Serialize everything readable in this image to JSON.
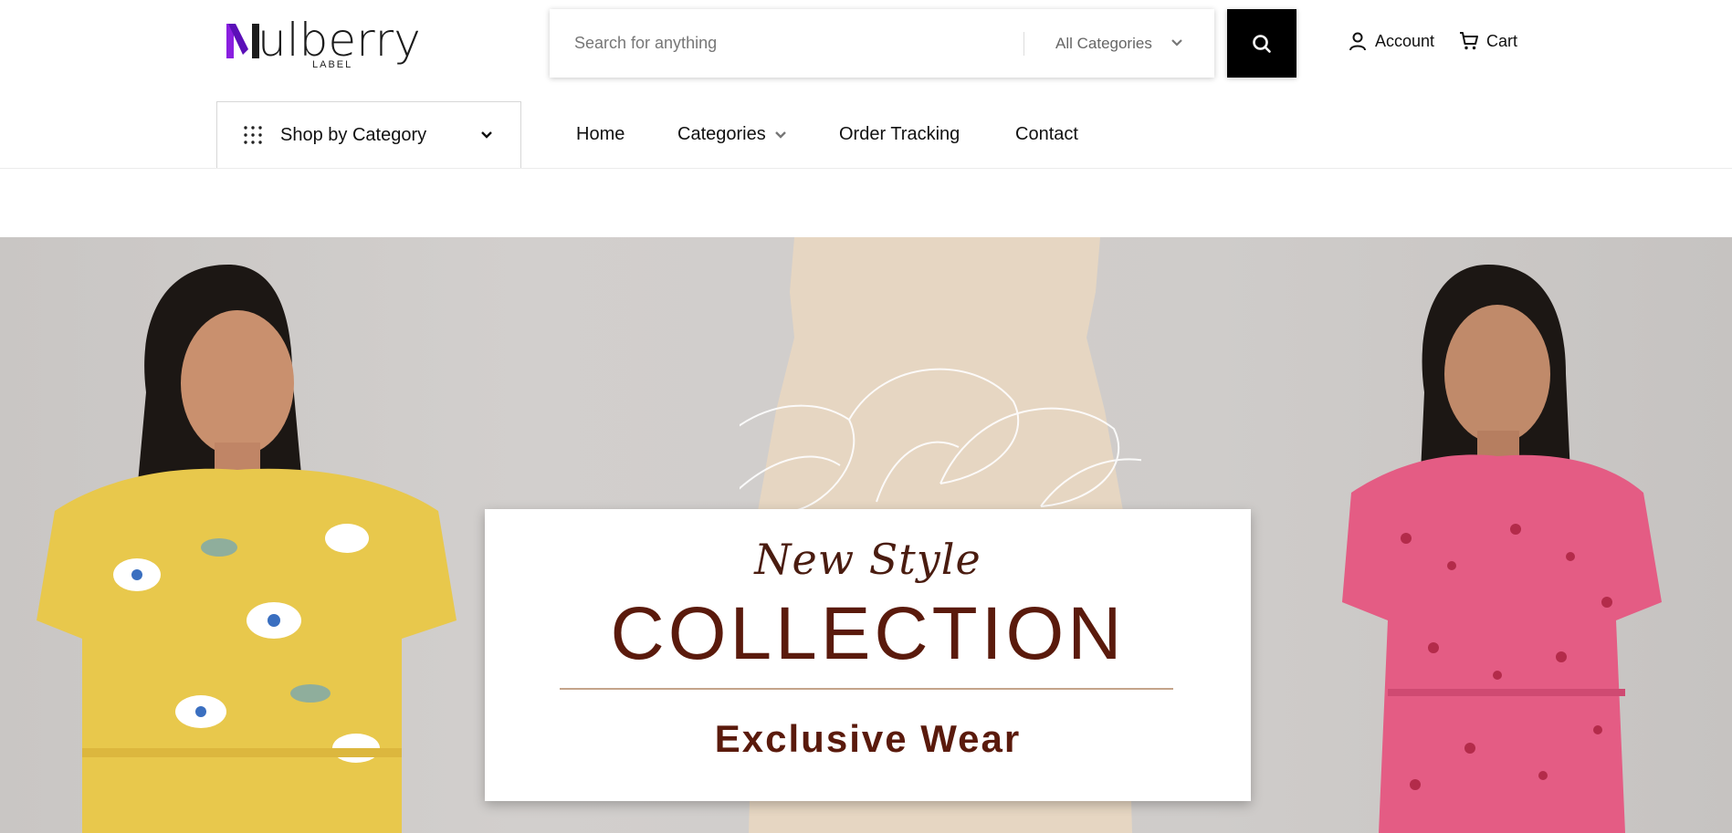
{
  "brand": {
    "name": "ulberry",
    "label": "LABEL",
    "accent": "#7b12d6"
  },
  "search": {
    "placeholder": "Search for anything",
    "category": "All Categories"
  },
  "header": {
    "account": "Account",
    "cart": "Cart"
  },
  "nav": {
    "shop_by_category": "Shop by Category",
    "items": [
      "Home",
      "Categories",
      "Order Tracking",
      "Contact"
    ]
  },
  "hero": {
    "line1": "New Style",
    "line2": "COLLECTION",
    "line3": "Exclusive Wear",
    "text_color": "#5a1a0c"
  },
  "icons": [
    "search-icon",
    "user-icon",
    "cart-icon",
    "grid-icon",
    "chevron-down-icon"
  ]
}
